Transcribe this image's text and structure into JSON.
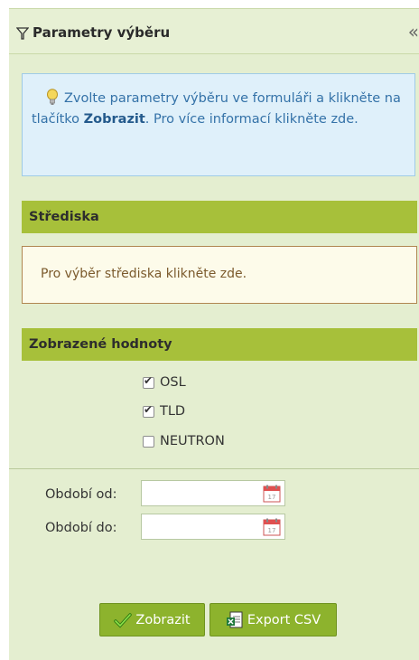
{
  "header": {
    "title": "Parametry výběru",
    "collapse_glyph": "«"
  },
  "info": {
    "text_before": "Zvolte parametry výběru ve formuláři a klikněte na tlačítko ",
    "text_bold": "Zobrazit",
    "text_after": ". Pro více informací klikněte zde.",
    "icon": "lightbulb-icon"
  },
  "strediska": {
    "heading": "Střediska",
    "notice": "Pro výběr střediska klikněte zde."
  },
  "values": {
    "heading": "Zobrazené hodnoty",
    "options": [
      {
        "label": "OSL",
        "checked": true
      },
      {
        "label": "TLD",
        "checked": true
      },
      {
        "label": "NEUTRON",
        "checked": false
      }
    ]
  },
  "period": {
    "from_label": "Období od:",
    "to_label": "Období do:",
    "from_value": "",
    "to_value": ""
  },
  "buttons": {
    "show_label": "Zobrazit",
    "export_label": "Export CSV"
  },
  "colors": {
    "panel_bg": "#e4eed0",
    "section_bar": "#a7c03a",
    "info_bg": "#dff0fa",
    "info_text": "#3472a8",
    "button_bg": "#8db32d"
  }
}
